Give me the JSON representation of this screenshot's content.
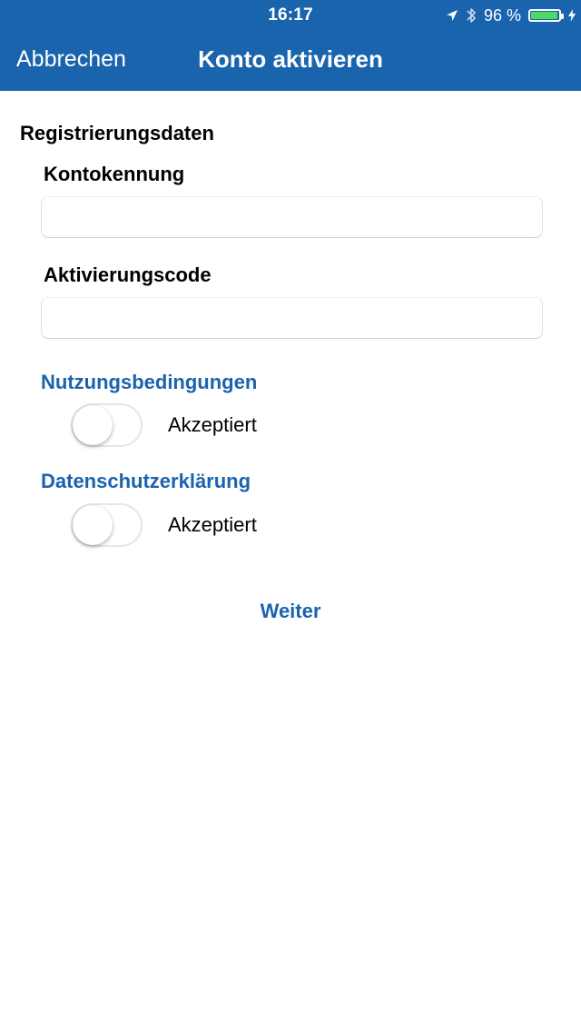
{
  "status_bar": {
    "time": "16:17",
    "battery_percent": "96 %",
    "battery_level": 0.96,
    "icons": [
      "location-arrow-icon",
      "bluetooth-icon",
      "battery-icon",
      "charging-bolt-icon"
    ]
  },
  "nav": {
    "cancel_label": "Abbrechen",
    "title": "Konto aktivieren"
  },
  "form": {
    "section_title": "Registrierungsdaten",
    "account_id_label": "Kontokennung",
    "account_id_value": "",
    "activation_code_label": "Aktivierungscode",
    "activation_code_value": ""
  },
  "terms": {
    "title": "Nutzungsbedingungen",
    "toggle_label": "Akzeptiert",
    "accepted": false
  },
  "privacy": {
    "title": "Datenschutzerklärung",
    "toggle_label": "Akzeptiert",
    "accepted": false
  },
  "next_label": "Weiter",
  "colors": {
    "brand_blue": "#1a63ad",
    "battery_green": "#4cd964",
    "background": "#ffffff"
  }
}
